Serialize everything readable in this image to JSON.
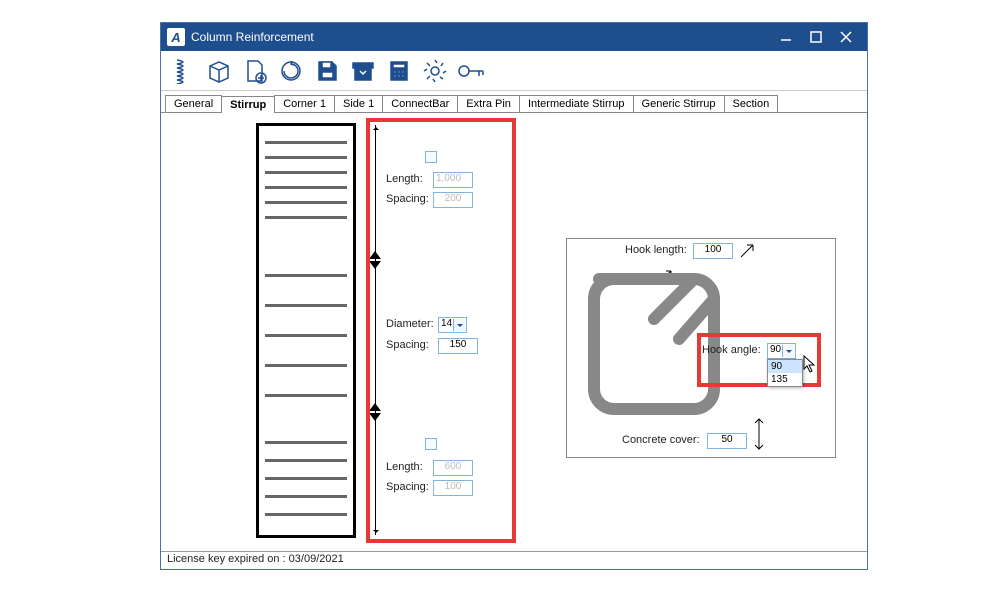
{
  "window": {
    "title": "Column Reinforcement"
  },
  "tabs": [
    "General",
    "Stirrup",
    "Corner 1",
    "Side 1",
    "ConnectBar",
    "Extra Pin",
    "Intermediate Stirrup",
    "Generic Stirrup",
    "Section"
  ],
  "zone_top": {
    "length_label": "Length:",
    "length": "1,000",
    "spacing_label": "Spacing:",
    "spacing": "200"
  },
  "zone_mid": {
    "diameter_label": "Diameter:",
    "diameter": "14",
    "spacing_label": "Spacing:",
    "spacing": "150"
  },
  "zone_bottom": {
    "length_label": "Length:",
    "length": "600",
    "spacing_label": "Spacing:",
    "spacing": "100"
  },
  "hook": {
    "length_label": "Hook length:",
    "length": "100",
    "angle_label": "Hook angle:",
    "angle": "90",
    "options": [
      "90",
      "135"
    ],
    "cover_label": "Concrete cover:",
    "cover": "50"
  },
  "status": "License key expired on : 03/09/2021",
  "icons": {
    "spring": "spring",
    "box": "box",
    "add": "add",
    "refresh": "refresh",
    "save": "save",
    "archive": "archive",
    "calc": "calc",
    "gear": "gear",
    "key": "key"
  }
}
